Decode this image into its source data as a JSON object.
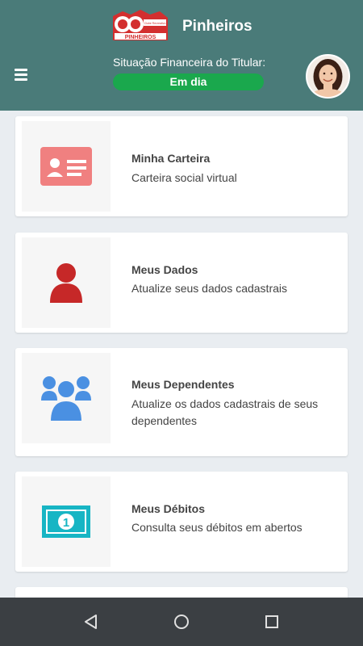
{
  "header": {
    "club_name": "Pinheiros",
    "status_caption": "Situação Financeira do Titular:",
    "status_value": "Em dia",
    "logo_text": "PINHEIROS",
    "logo_subtext": "Clube Recreativo"
  },
  "cards": [
    {
      "title": "Minha Carteira",
      "subtitle": "Carteira social virtual",
      "icon": "id-card-icon",
      "color": "#f08080"
    },
    {
      "title": "Meus Dados",
      "subtitle": "Atualize seus dados cadastrais",
      "icon": "user-icon",
      "color": "#c62828"
    },
    {
      "title": "Meus Dependentes",
      "subtitle": "Atualize os dados cadastrais de seus dependentes",
      "icon": "users-group-icon",
      "color": "#4a90e2"
    },
    {
      "title": "Meus Débitos",
      "subtitle": "Consulta seus débitos em abertos",
      "icon": "money-bill-icon",
      "color": "#17b5c4"
    }
  ],
  "colors": {
    "header_bg": "#4a7b79",
    "status_badge": "#1aa84d",
    "page_bg": "#e9edf1",
    "navbar_bg": "#3b3f43"
  },
  "navbar": {
    "icons": [
      "back-icon",
      "home-icon",
      "recents-icon"
    ]
  }
}
